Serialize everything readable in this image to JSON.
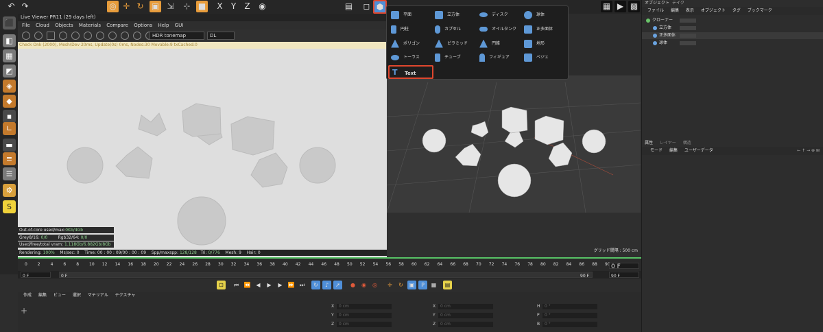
{
  "live_viewer": {
    "title": "Live Viewer PR11 (29 days left)",
    "menu": [
      "File",
      "Cloud",
      "Objects",
      "Materials",
      "Compare",
      "Options",
      "Help",
      "GUI"
    ],
    "tonemap": "HDR tonemap",
    "dl": "DL",
    "path_bar": "Check Onk (2000), Mesh(Dev 20ms, Update(0s) 0ms, Nodes:30 Movable:9 txCached:0",
    "stats": {
      "out_of_core": "Out-of-core used/max:",
      "out_of_core_val": "0Kb/4Gb",
      "grey": "Grey8/16:",
      "grey_val": "0/0",
      "rgb": "Rgb32/64:",
      "rgb_val": "0/0",
      "vram": "Used/free/total vram:",
      "vram_val": "1.118Gb/6.882Gb/8Gb"
    },
    "status": {
      "rendering": "Rendering:",
      "rendering_val": "100%",
      "mssec": "Ms/sec:",
      "mssec_val": "0",
      "time": "Time:",
      "time_val": "00 : 00 : 09/00 : 00 : 09",
      "spp": "Spp/maxspp:",
      "spp_val": "128/128",
      "tri": "Tri:",
      "tri_val": "0/776",
      "mesh": "Mesh:",
      "mesh_val": "9",
      "hair": "Hair:",
      "hair_val": "0"
    }
  },
  "dropdown": {
    "items": [
      {
        "label": "平面",
        "icon": "plane-icon"
      },
      {
        "label": "立方体",
        "icon": "cube-icon"
      },
      {
        "label": "ディスク",
        "icon": "disc-icon"
      },
      {
        "label": "球体",
        "icon": "sphere-icon"
      },
      {
        "label": "円柱",
        "icon": "cylinder-icon"
      },
      {
        "label": "カプセル",
        "icon": "capsule-icon"
      },
      {
        "label": "オイルタンク",
        "icon": "oiltank-icon"
      },
      {
        "label": "正多面体",
        "icon": "platonic-icon"
      },
      {
        "label": "ポリゴン",
        "icon": "polygon-icon"
      },
      {
        "label": "ピラミッド",
        "icon": "pyramid-icon"
      },
      {
        "label": "円錐",
        "icon": "cone-icon"
      },
      {
        "label": "地形",
        "icon": "landscape-icon"
      },
      {
        "label": "トーラス",
        "icon": "torus-icon"
      },
      {
        "label": "チューブ",
        "icon": "tube-icon"
      },
      {
        "label": "フィギュア",
        "icon": "figure-icon"
      },
      {
        "label": "ベジェ",
        "icon": "bezier-icon"
      }
    ],
    "text_item": "Text"
  },
  "viewport": {
    "grid_label": "グリッド間隔 : 500 cm"
  },
  "right_panel": {
    "tabs": [
      "オブジェクト",
      "テイク"
    ],
    "menu": [
      "ファイル",
      "編集",
      "表示",
      "オブジェクト",
      "タグ",
      "ブックマーク"
    ],
    "objects": [
      {
        "name": "クローナー"
      },
      {
        "name": "立方体"
      },
      {
        "name": "正多面体"
      },
      {
        "name": "球体"
      }
    ],
    "attr_tabs": [
      "属性",
      "レイヤー",
      "構造"
    ],
    "attr_menu": [
      "モード",
      "編集",
      "ユーザーデータ"
    ]
  },
  "timeline": {
    "ticks": [
      "0",
      "2",
      "4",
      "6",
      "8",
      "10",
      "12",
      "14",
      "16",
      "18",
      "20",
      "22",
      "24",
      "26",
      "28",
      "30",
      "32",
      "34",
      "36",
      "38",
      "40",
      "42",
      "44",
      "46",
      "48",
      "50",
      "52",
      "54",
      "56",
      "58",
      "60",
      "62",
      "64",
      "66",
      "68",
      "70",
      "72",
      "74",
      "76",
      "78",
      "80",
      "82",
      "84",
      "86",
      "88",
      "90"
    ],
    "current_frame_right": "0 F",
    "start": "0 F",
    "start2": "0 F",
    "end": "90 F",
    "end2": "90 F"
  },
  "material_panel": {
    "menu": [
      "作成",
      "編集",
      "ビュー",
      "選択",
      "マテリアル",
      "テクスチャ"
    ]
  },
  "coord_panel": {
    "rows": [
      {
        "axis": "X",
        "val": "0 cm",
        "axis2": "X",
        "val2": "0 cm",
        "axis3": "H",
        "val3": "0 °"
      },
      {
        "axis": "Y",
        "val": "0 cm",
        "axis2": "Y",
        "val2": "0 cm",
        "axis3": "P",
        "val3": "0 °"
      },
      {
        "axis": "Z",
        "val": "0 cm",
        "axis2": "Z",
        "val2": "0 cm",
        "axis3": "B",
        "val3": "0 °"
      }
    ]
  },
  "colors": {
    "accent_red": "#e0472e",
    "accent_blue": "#4f8fd8",
    "status_green": "#58c466"
  }
}
